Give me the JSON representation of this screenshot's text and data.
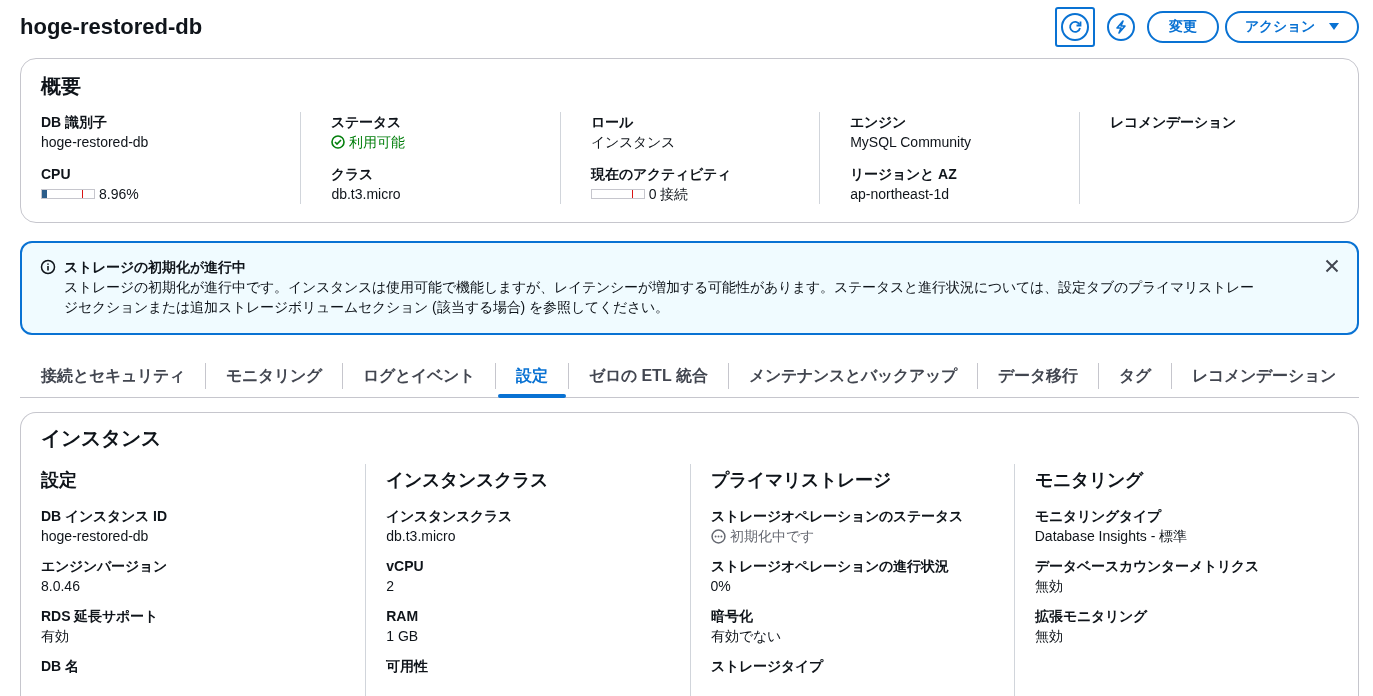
{
  "page": {
    "title": "hoge-restored-db"
  },
  "header_buttons": [
    {
      "kind": "refresh",
      "focused": true
    },
    {
      "kind": "bolt",
      "focused": false
    },
    {
      "kind": "text",
      "label": "変更"
    },
    {
      "kind": "dropdown",
      "label": "アクション"
    }
  ],
  "overview": {
    "title": "概要",
    "columns": [
      [
        {
          "kind": "text",
          "label": "DB 識別子",
          "value": "hoge-restored-db"
        },
        {
          "kind": "meter",
          "label": "CPU",
          "level": 0.09,
          "value": "8.96%"
        }
      ],
      [
        {
          "kind": "status",
          "label": "ステータス",
          "value": "利用可能"
        },
        {
          "kind": "text",
          "label": "クラス",
          "value": "db.t3.micro"
        }
      ],
      [
        {
          "kind": "text",
          "label": "ロール",
          "value": "インスタンス"
        },
        {
          "kind": "meter",
          "label": "現在のアクティビティ",
          "level": 0,
          "value": "0 接続"
        }
      ],
      [
        {
          "kind": "text",
          "label": "エンジン",
          "value": "MySQL Community"
        },
        {
          "kind": "text",
          "label": "リージョンと AZ",
          "value": "ap-northeast-1d"
        }
      ],
      [
        {
          "kind": "text",
          "label": "レコメンデーション"
        }
      ]
    ]
  },
  "alert": {
    "title": "ストレージの初期化が進行中",
    "message": "ストレージの初期化が進行中です。インスタンスは使用可能で機能しますが、レイテンシーが増加する可能性があります。ステータスと進行状況については、設定タブのプライマリストレージセクションまたは追加ストレージボリュームセクション (該当する場合) を参照してください。"
  },
  "tabs": [
    {
      "label": "接続とセキュリティ",
      "selected": false
    },
    {
      "label": "モニタリング",
      "selected": false
    },
    {
      "label": "ログとイベント",
      "selected": false
    },
    {
      "label": "設定",
      "selected": true
    },
    {
      "label": "ゼロの ETL 統合",
      "selected": false
    },
    {
      "label": "メンテナンスとバックアップ",
      "selected": false
    },
    {
      "label": "データ移行",
      "selected": false
    },
    {
      "label": "タグ",
      "selected": false
    },
    {
      "label": "レコメンデーション",
      "selected": false
    }
  ],
  "instance": {
    "title": "インスタンス",
    "sections": [
      {
        "title": "設定",
        "fields": [
          {
            "kind": "text",
            "label": "DB インスタンス ID",
            "value": "hoge-restored-db"
          },
          {
            "kind": "text",
            "label": "エンジンバージョン",
            "value": "8.0.46"
          },
          {
            "kind": "text",
            "label": "RDS 延長サポート",
            "value": "有効"
          },
          {
            "kind": "text",
            "label": "DB 名"
          }
        ]
      },
      {
        "title": "インスタンスクラス",
        "fields": [
          {
            "kind": "text",
            "label": "インスタンスクラス",
            "value": "db.t3.micro"
          },
          {
            "kind": "text",
            "label": "vCPU",
            "value": "2"
          },
          {
            "kind": "text",
            "label": "RAM",
            "value": "1 GB"
          },
          {
            "kind": "text",
            "label": "可用性"
          }
        ]
      },
      {
        "title": "プライマリストレージ",
        "fields": [
          {
            "kind": "pending",
            "label": "ストレージオペレーションのステータス",
            "value": "初期化中です"
          },
          {
            "kind": "text",
            "label": "ストレージオペレーションの進行状況",
            "value": "0%"
          },
          {
            "kind": "text",
            "label": "暗号化",
            "value": "有効でない"
          },
          {
            "kind": "text",
            "label": "ストレージタイプ"
          }
        ]
      },
      {
        "title": "モニタリング",
        "fields": [
          {
            "kind": "text",
            "label": "モニタリングタイプ",
            "value": "Database Insights - 標準"
          },
          {
            "kind": "text",
            "label": "データベースカウンターメトリクス",
            "value": "無効"
          },
          {
            "kind": "text",
            "label": "拡張モニタリング",
            "value": "無効"
          }
        ]
      }
    ]
  }
}
